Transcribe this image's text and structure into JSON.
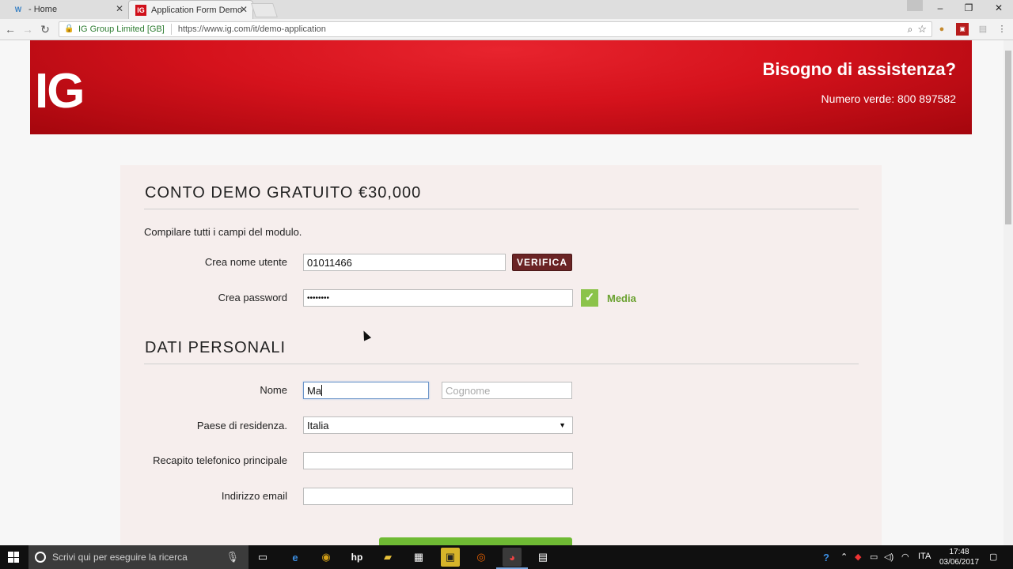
{
  "browser": {
    "tabs": [
      {
        "label": "- Home",
        "active": false
      },
      {
        "label": "Application Form Demo",
        "active": true
      }
    ],
    "window_controls": {
      "minimize": "–",
      "restore": "❐",
      "close": "✕"
    },
    "address": {
      "secure_label": "IG Group Limited [GB]",
      "url": "https://www.ig.com/it/demo-application"
    }
  },
  "banner": {
    "logo": "IG",
    "help_title": "Bisogno di assistenza?",
    "help_phone": "Numero verde: 800 897582"
  },
  "form": {
    "section1_title": "CONTO DEMO GRATUITO €30,000",
    "intro": "Compilare tutti i campi del modulo.",
    "username_label": "Crea nome utente",
    "username_value": "01011466",
    "verify_label": "VERIFICA",
    "password_label": "Crea password",
    "password_value": "••••••••",
    "password_strength": "Media",
    "section2_title": "DATI PERSONALI",
    "name_label": "Nome",
    "first_name_value": "Ma",
    "last_name_placeholder": "Cognome",
    "country_label": "Paese di residenza.",
    "country_value": "Italia",
    "phone_label": "Recapito telefonico principale",
    "email_label": "Indirizzo email"
  },
  "taskbar": {
    "search_placeholder": "Scrivi qui per eseguire la ricerca",
    "language": "ITA",
    "time": "17:48",
    "date": "03/06/2017"
  }
}
